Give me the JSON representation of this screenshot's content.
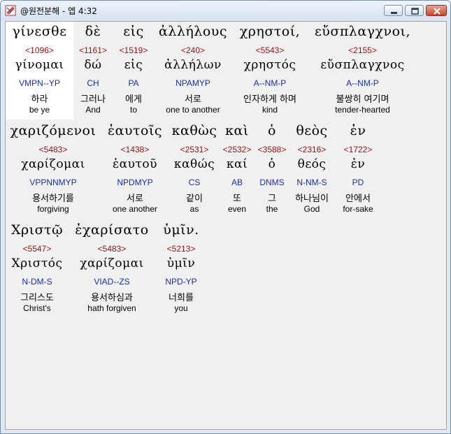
{
  "window": {
    "title": "@원전분해 - 엡 4:32"
  },
  "rows": [
    {
      "words": [
        {
          "greek": "γίνεσθε",
          "strong": "<1096>",
          "lemma": "γίνομαι",
          "parse": "VMPN--YP",
          "korean": "하라",
          "english": "be ye",
          "selected": true
        },
        {
          "greek": "δὲ",
          "strong": "<1161>",
          "lemma": "δώ",
          "parse": "CH",
          "korean": "그러나",
          "english": "And"
        },
        {
          "greek": "εἰς",
          "strong": "<1519>",
          "lemma": "εἰς",
          "parse": "PA",
          "korean": "에게",
          "english": "to"
        },
        {
          "greek": "ἀλλήλους",
          "strong": "<240>",
          "lemma": "ἀλλήλων",
          "parse": "NPAMYP",
          "korean": "서로",
          "english": "one to another"
        },
        {
          "greek": "χρηστοί,",
          "strong": "<5543>",
          "lemma": "χρηστός",
          "parse": "A--NM-P",
          "korean": "인자하게 하며",
          "english": "kind"
        },
        {
          "greek": "εὔσπλαγχνοι,",
          "strong": "<2155>",
          "lemma": "εὔσπλαγχνος",
          "parse": "A--NM-P",
          "korean": "불쌍히 여기며",
          "english": "tender-hearted"
        }
      ]
    },
    {
      "words": [
        {
          "greek": "χαριζόμενοι",
          "strong": "<5483>",
          "lemma": "χαρίζομαι",
          "parse": "VPPNNMYP",
          "korean": "용서하기를",
          "english": "forgiving"
        },
        {
          "greek": "ἑαυτοῖς",
          "strong": "<1438>",
          "lemma": "ἑαυτοῦ",
          "parse": "NPDMYP",
          "korean": "서로",
          "english": "one another"
        },
        {
          "greek": "καθὼς",
          "strong": "<2531>",
          "lemma": "καθώς",
          "parse": "CS",
          "korean": "같이",
          "english": "as"
        },
        {
          "greek": "καὶ",
          "strong": "<2532>",
          "lemma": "καί",
          "parse": "AB",
          "korean": "또",
          "english": "even"
        },
        {
          "greek": "ὁ",
          "strong": "<3588>",
          "lemma": "ὁ",
          "parse": "DNMS",
          "korean": "그",
          "english": "the"
        },
        {
          "greek": "θεὸς",
          "strong": "<2316>",
          "lemma": "θεός",
          "parse": "N-NM-S",
          "korean": "하나님이",
          "english": "God"
        },
        {
          "greek": "ἐν",
          "strong": "<1722>",
          "lemma": "ἐν",
          "parse": "PD",
          "korean": "안에서",
          "english": "for-sake"
        }
      ]
    },
    {
      "words": [
        {
          "greek": "Χριστῷ",
          "strong": "<5547>",
          "lemma": "Χριστός",
          "parse": "N-DM-S",
          "korean": "그리스도",
          "english": "Christ's"
        },
        {
          "greek": "ἐχαρίσατο",
          "strong": "<5483>",
          "lemma": "χαρίζομαι",
          "parse": "VIAD--ZS",
          "korean": "용서하심과",
          "english": "hath forgiven"
        },
        {
          "greek": "ὑμῖν.",
          "strong": "<5213>",
          "lemma": "ὑμῖν",
          "parse": "NPD-YP",
          "korean": "너희를",
          "english": "you"
        }
      ]
    }
  ],
  "icons": {
    "app": "app-icon",
    "minimize": "minimize-icon",
    "maximize": "maximize-icon",
    "close": "close-icon"
  },
  "colors": {
    "strong": "#9a1010",
    "parse": "#1a2ea0",
    "close": "#c8442b",
    "selection": "#ffffff"
  }
}
